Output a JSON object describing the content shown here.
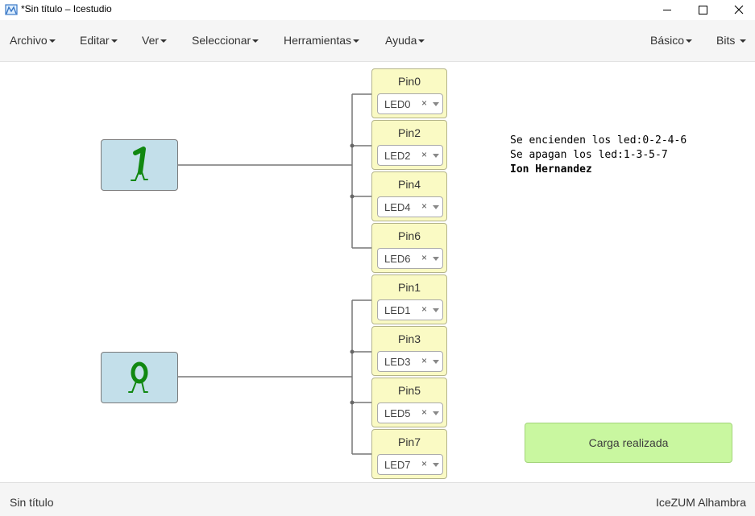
{
  "window": {
    "title": "*Sin título – Icestudio",
    "app_icon": "icestudio-logo-icon"
  },
  "menu": {
    "items": [
      {
        "label": "Archivo"
      },
      {
        "label": "Editar"
      },
      {
        "label": "Ver"
      },
      {
        "label": "Seleccionar"
      },
      {
        "label": "Herramientas"
      },
      {
        "label": "Ayuda"
      }
    ],
    "right_items": [
      {
        "label": "Básico"
      },
      {
        "label": "Bits"
      }
    ]
  },
  "canvas": {
    "constants": [
      {
        "value": "1",
        "color": "#118811"
      },
      {
        "value": "0",
        "color": "#118811"
      }
    ],
    "pins": [
      {
        "name": "Pin0",
        "value": "LED0"
      },
      {
        "name": "Pin2",
        "value": "LED2"
      },
      {
        "name": "Pin4",
        "value": "LED4"
      },
      {
        "name": "Pin6",
        "value": "LED6"
      },
      {
        "name": "Pin1",
        "value": "LED1"
      },
      {
        "name": "Pin3",
        "value": "LED3"
      },
      {
        "name": "Pin5",
        "value": "LED5"
      },
      {
        "name": "Pin7",
        "value": "LED7"
      }
    ],
    "clear_symbol": "×",
    "comment": {
      "line1": "Se encienden los led:0-2-4-6",
      "line2": "Se apagan los led:1-3-5-7",
      "line3": "Ion Hernandez"
    },
    "alert": "Carga realizada"
  },
  "footer": {
    "left": "Sin título",
    "right": "IceZUM Alhambra"
  },
  "colors": {
    "menubar_bg": "#f5f5f5",
    "constant_block": "#c3dfea",
    "pin_block": "#fafac4",
    "alert_bg": "#c9f7a0",
    "wire": "#777777"
  }
}
